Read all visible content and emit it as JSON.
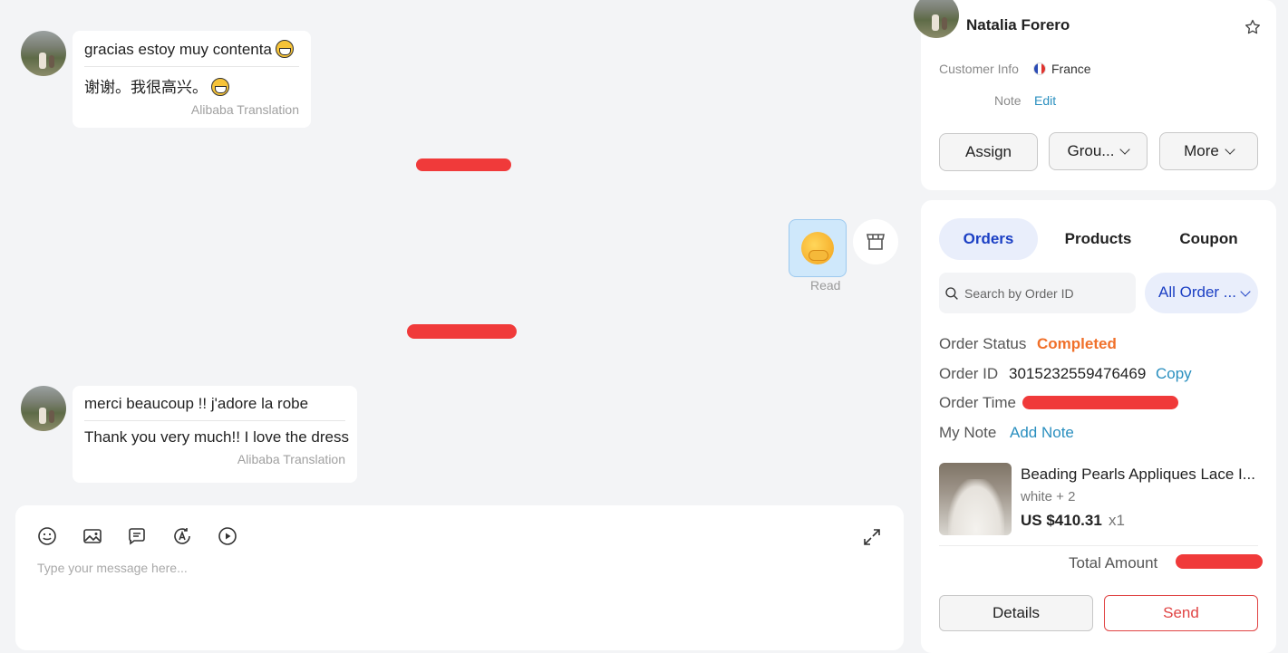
{
  "chat": {
    "messages": [
      {
        "original": "gracias estoy muy contenta",
        "translation": "谢谢。我很高兴。",
        "source": "Alibaba Translation",
        "emoji": "grinning-face"
      },
      {
        "original": "merci beaucoup !! j'adore la robe",
        "translation": "Thank you very much!! I love the dress",
        "source": "Alibaba Translation"
      }
    ],
    "sent_sticker": {
      "emoji": "hugging-face",
      "status": "Read"
    },
    "composer": {
      "placeholder": "Type your message here...",
      "tools": [
        "emoji-icon",
        "image-icon",
        "quick-reply-icon",
        "translate-icon",
        "video-icon",
        "expand-icon"
      ]
    }
  },
  "customer": {
    "name": "Natalia Forero",
    "info_label": "Customer Info",
    "country": "France",
    "note_label": "Note",
    "edit_label": "Edit",
    "buttons": {
      "assign": "Assign",
      "group": "Grou...",
      "more": "More"
    }
  },
  "orders_panel": {
    "tabs": [
      {
        "label": "Orders",
        "active": true
      },
      {
        "label": "Products",
        "active": false
      },
      {
        "label": "Coupon",
        "active": false
      }
    ],
    "search_placeholder": "Search by Order ID",
    "filter_label": "All Order ...",
    "order": {
      "status_label": "Order Status",
      "status_value": "Completed",
      "id_label": "Order ID",
      "id_value": "3015232559476469",
      "copy_label": "Copy",
      "time_label": "Order Time",
      "note_label": "My Note",
      "add_note_label": "Add Note",
      "product": {
        "title": "Beading Pearls Appliques Lace I...",
        "variant": "white + 2",
        "price": "US $410.31",
        "qty": "x1"
      },
      "total_label": "Total Amount"
    },
    "details_label": "Details",
    "send_label": "Send"
  },
  "colors": {
    "accent_blue": "#1b3fc4",
    "status_orange": "#f0702a",
    "link_teal": "#2a8fbf",
    "send_red": "#e04444",
    "redaction_red": "#f03a3a"
  }
}
